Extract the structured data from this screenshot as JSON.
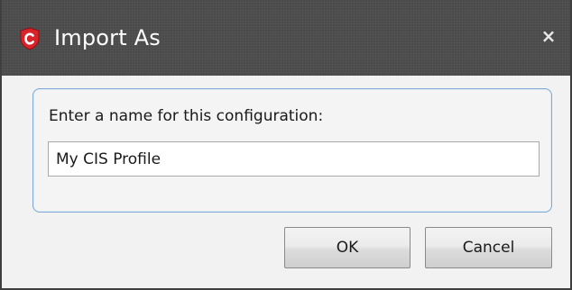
{
  "dialog": {
    "title": "Import As",
    "app_icon": "comodo-shield-icon",
    "close_icon": "close-icon",
    "close_glyph": "×",
    "prompt": "Enter a name for this configuration:",
    "name_field": {
      "value": "My CIS Profile",
      "placeholder": ""
    },
    "ok_label": "OK",
    "cancel_label": "Cancel"
  },
  "colors": {
    "titlebar": "#4a4a4a",
    "app_icon_red": "#d9232a",
    "group_border": "#7fa9d4",
    "dialog_background": "#f2f2f2"
  }
}
